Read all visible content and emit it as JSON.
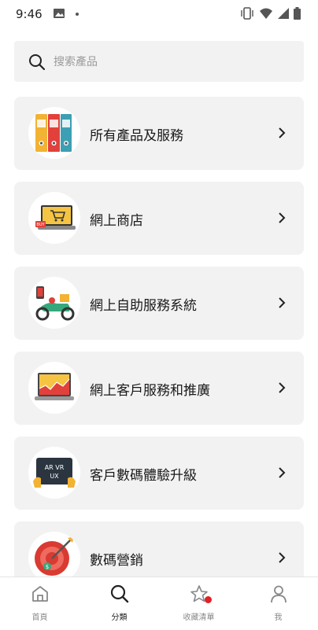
{
  "status_bar": {
    "time": "9:46"
  },
  "search": {
    "placeholder": "搜索產品"
  },
  "categories": [
    {
      "label": "所有產品及服務",
      "icon": "binders-icon"
    },
    {
      "label": "網上商店",
      "icon": "laptop-cart-icon"
    },
    {
      "label": "網上自助服務系統",
      "icon": "delivery-scooter-icon"
    },
    {
      "label": "網上客戶服務和推廣",
      "icon": "laptop-chart-icon"
    },
    {
      "label": "客戶數碼體驗升級",
      "icon": "ar-vr-ux-tablet-icon"
    },
    {
      "label": "數碼營銷",
      "icon": "target-dart-icon"
    }
  ],
  "ar_tablet": {
    "line1": "AR VR",
    "line2": "UX"
  },
  "bottom_nav": [
    {
      "label": "首頁",
      "icon": "home-icon"
    },
    {
      "label": "分類",
      "icon": "search-icon",
      "active": true
    },
    {
      "label": "收藏清單",
      "icon": "star-icon",
      "badge": true
    },
    {
      "label": "我",
      "icon": "person-icon"
    }
  ],
  "colors": {
    "accent_red": "#e41e26",
    "card_bg": "#f2f2f2"
  }
}
